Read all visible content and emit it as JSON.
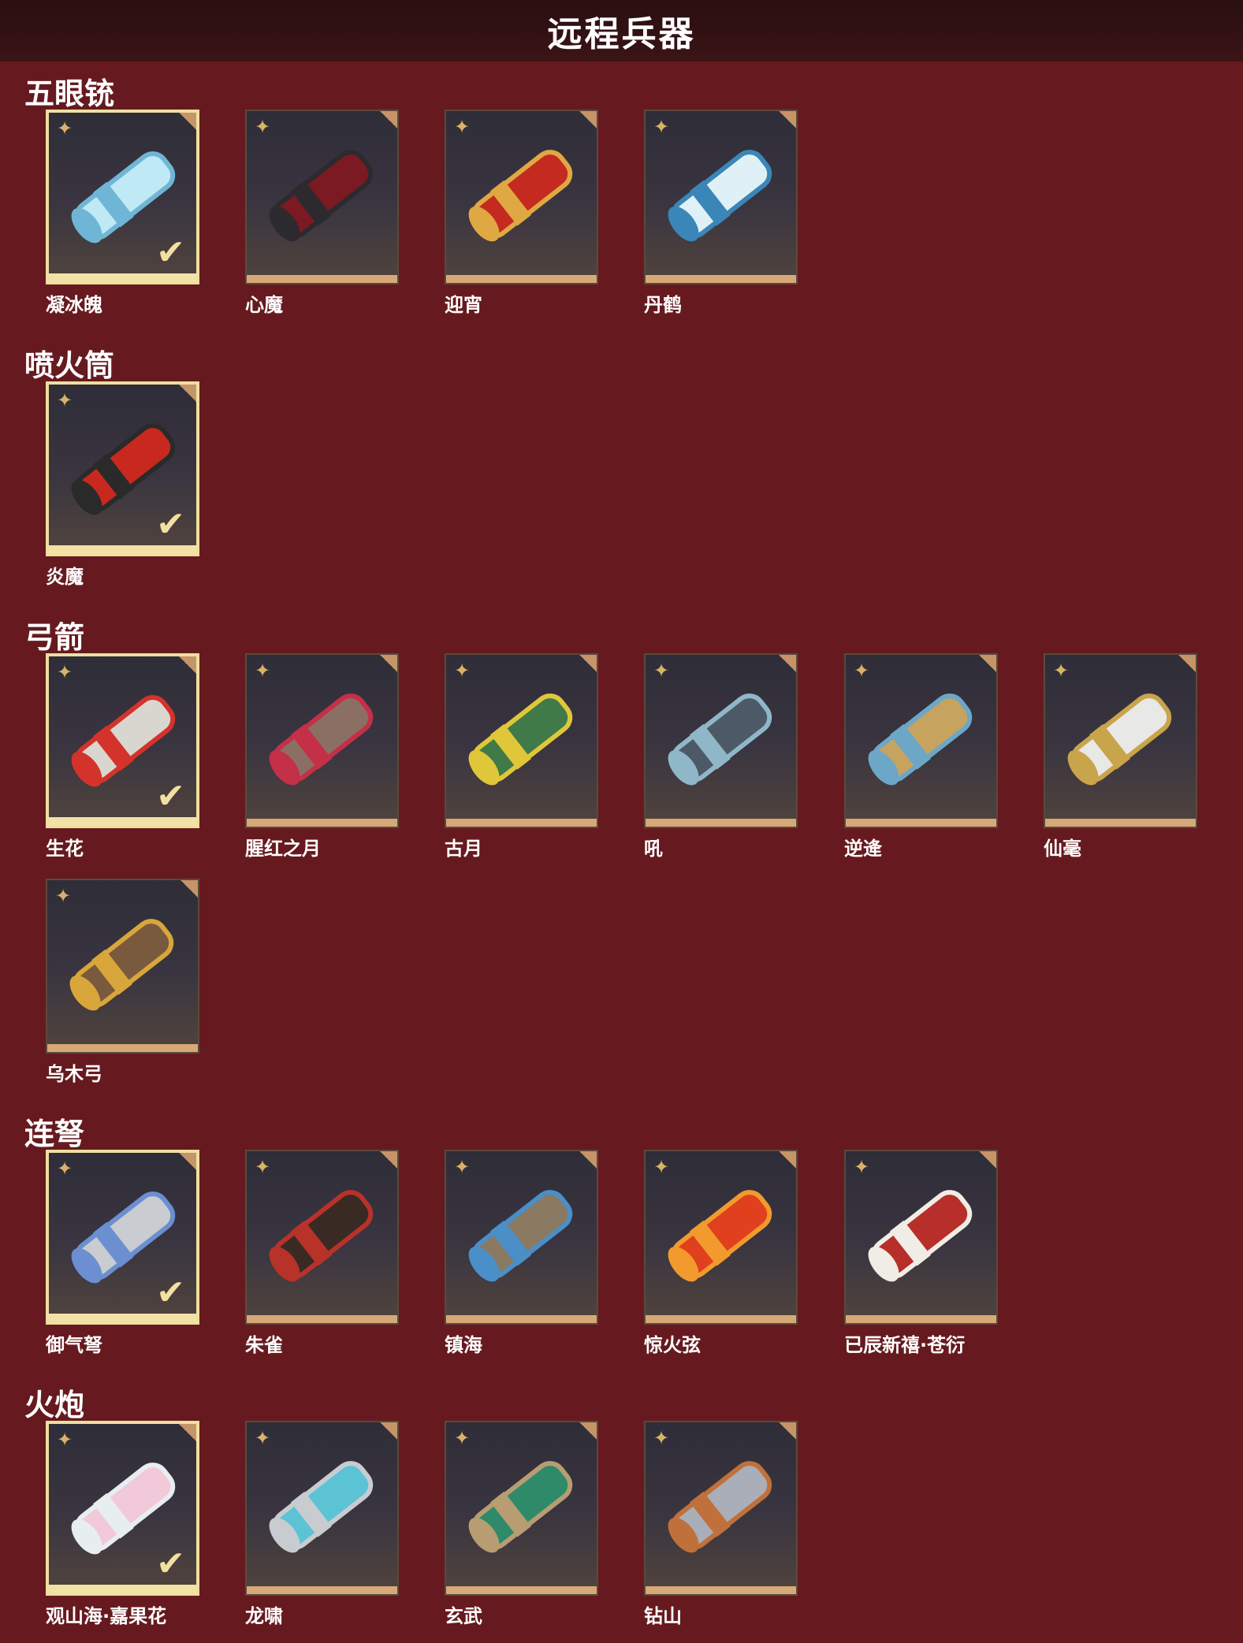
{
  "page_title": "远程兵器",
  "sections": [
    {
      "title": "五眼铳",
      "items": [
        {
          "name": "凝冰魄",
          "owned": true,
          "palette": [
            "#bfe9f4",
            "#6fb6d6"
          ]
        },
        {
          "name": "心魔",
          "owned": false,
          "palette": [
            "#7b1a22",
            "#2d2a2f"
          ]
        },
        {
          "name": "迎宵",
          "owned": false,
          "palette": [
            "#c52a20",
            "#e0a843"
          ]
        },
        {
          "name": "丹鹤",
          "owned": false,
          "palette": [
            "#dff1f7",
            "#3b86b8"
          ]
        }
      ]
    },
    {
      "title": "喷火筒",
      "items": [
        {
          "name": "炎魔",
          "owned": true,
          "palette": [
            "#c8281e",
            "#2a2a2a"
          ]
        }
      ]
    },
    {
      "title": "弓箭",
      "items": [
        {
          "name": "生花",
          "owned": true,
          "palette": [
            "#d9d6d0",
            "#d4332b"
          ]
        },
        {
          "name": "腥红之月",
          "owned": false,
          "palette": [
            "#8b6f64",
            "#c43047"
          ]
        },
        {
          "name": "古月",
          "owned": false,
          "palette": [
            "#3f7a48",
            "#e0c73a"
          ]
        },
        {
          "name": "吼",
          "owned": false,
          "palette": [
            "#4b5a66",
            "#8fb7c8"
          ]
        },
        {
          "name": "逆逄",
          "owned": false,
          "palette": [
            "#c6a35e",
            "#6ca7c8"
          ]
        },
        {
          "name": "仙毫",
          "owned": false,
          "palette": [
            "#e8e8e6",
            "#c8a44a"
          ]
        },
        {
          "name": "乌木弓",
          "owned": false,
          "palette": [
            "#7a5a3e",
            "#d8a63a"
          ]
        }
      ]
    },
    {
      "title": "连弩",
      "items": [
        {
          "name": "御气弩",
          "owned": true,
          "palette": [
            "#c9ccd0",
            "#6b8fd0"
          ]
        },
        {
          "name": "朱雀",
          "owned": false,
          "palette": [
            "#3a2a24",
            "#b8322a"
          ]
        },
        {
          "name": "镇海",
          "owned": false,
          "palette": [
            "#8a7a62",
            "#4a8fc8"
          ]
        },
        {
          "name": "惊火弦",
          "owned": false,
          "palette": [
            "#e0401e",
            "#f29a2e"
          ]
        },
        {
          "name": "已辰新禧·苍衍",
          "owned": false,
          "palette": [
            "#b82e2a",
            "#f0ece6"
          ]
        }
      ]
    },
    {
      "title": "火炮",
      "items": [
        {
          "name": "观山海·嘉果花",
          "owned": true,
          "palette": [
            "#f2c9d8",
            "#e8eef0"
          ]
        },
        {
          "name": "龙啸",
          "owned": false,
          "palette": [
            "#5cc3d4",
            "#c8ccd0"
          ]
        },
        {
          "name": "玄武",
          "owned": false,
          "palette": [
            "#2f8a6a",
            "#b89c72"
          ]
        },
        {
          "name": "钻山",
          "owned": false,
          "palette": [
            "#a9aeb8",
            "#c0703a"
          ]
        }
      ]
    }
  ],
  "icons": {
    "star": "rarity-star-icon",
    "check": "equipped-check-icon",
    "corner": "corner-tag-icon"
  },
  "colors": {
    "background": "#661a1f",
    "header": "#2a0e10",
    "frame_owned": "#efdfa0",
    "frame_band": "#d7a979"
  }
}
